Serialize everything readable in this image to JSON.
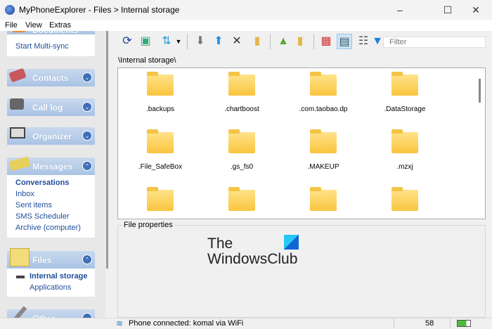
{
  "window": {
    "title": "MyPhoneExplorer -  Files > Internal storage",
    "minimize": "–",
    "maximize": "☐",
    "close": "✕"
  },
  "menu": [
    "File",
    "View",
    "Extras"
  ],
  "sidebar": {
    "documents": {
      "label": "Documents",
      "items": [
        "Start Multi-sync"
      ]
    },
    "contacts": {
      "label": "Contacts"
    },
    "calllog": {
      "label": "Call log"
    },
    "organizer": {
      "label": "Organizer"
    },
    "messages": {
      "label": "Messages",
      "items": [
        "Conversations",
        "Inbox",
        "Sent items",
        "SMS Scheduler",
        "Archive (computer)"
      ]
    },
    "files": {
      "label": "Files",
      "items": [
        "Internal storage",
        "Applications"
      ]
    },
    "other": {
      "label": "Other"
    }
  },
  "toolbar": {
    "filter_placeholder": "Filter"
  },
  "path": "\\Internal storage\\",
  "folders": [
    ".backups",
    ".chartboost",
    ".com.taobao.dp",
    ".DataStorage",
    ".File_SafeBox",
    ".gs_fs0",
    ".MAKEUP",
    ".mzxj",
    "",
    "",
    "",
    ""
  ],
  "properties": {
    "label": "File properties"
  },
  "watermark": {
    "line1": "The",
    "line2": "WindowsClub"
  },
  "status": {
    "text": "Phone connected: komal via WiFi",
    "count": "58"
  }
}
